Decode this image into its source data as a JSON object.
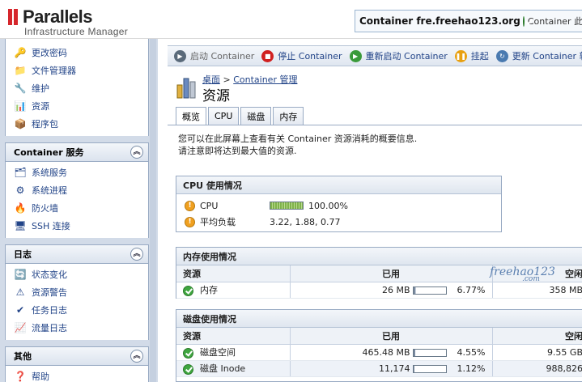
{
  "header": {
    "logo_name": "Parallels",
    "logo_sub": "Infrastructure Manager",
    "container_name": "Container fre.freehao123.org",
    "container_status": "Container 此时的状"
  },
  "sidebar": {
    "top_items": [
      {
        "label": "更改密码",
        "icon": "key-icon"
      },
      {
        "label": "文件管理器",
        "icon": "folder-icon"
      },
      {
        "label": "维护",
        "icon": "wrench-icon"
      },
      {
        "label": "资源",
        "icon": "bar-chart-icon"
      },
      {
        "label": "程序包",
        "icon": "package-icon"
      }
    ],
    "sections": [
      {
        "title": "Container 服务",
        "items": [
          {
            "label": "系统服务",
            "icon": "services-icon"
          },
          {
            "label": "系统进程",
            "icon": "gears-icon"
          },
          {
            "label": "防火墙",
            "icon": "firewall-icon"
          },
          {
            "label": "SSH 连接",
            "icon": "terminal-icon"
          }
        ]
      },
      {
        "title": "日志",
        "items": [
          {
            "label": "状态变化",
            "icon": "status-log-icon"
          },
          {
            "label": "资源警告",
            "icon": "warning-log-icon"
          },
          {
            "label": "任务日志",
            "icon": "task-log-icon"
          },
          {
            "label": "流量日志",
            "icon": "traffic-log-icon"
          }
        ]
      },
      {
        "title": "其他",
        "items": [
          {
            "label": "帮助",
            "icon": "help-icon"
          }
        ]
      }
    ]
  },
  "toolbar": {
    "start": "启动 Container",
    "stop": "停止 Container",
    "restart": "重新启动 Container",
    "suspend": "挂起",
    "update": "更新 Container 软件"
  },
  "breadcrumb": {
    "home": "桌面",
    "sep": ">",
    "current": "Container 管理"
  },
  "page_title": "资源",
  "tabs": [
    "概览",
    "CPU",
    "磁盘",
    "内存"
  ],
  "intro": {
    "line1": "您可以在此屏幕上查看有关 Container 资源消耗的概要信息.",
    "line2": "请注意即将达到最大值的资源."
  },
  "cpu_panel": {
    "title": "CPU 使用情况",
    "rows": [
      {
        "label": "CPU",
        "value": "100.00%",
        "fill": 1.0
      },
      {
        "label": "平均负载",
        "value": "3.22, 1.88, 0.77"
      }
    ]
  },
  "mem_panel": {
    "title": "内存使用情况",
    "headers": {
      "resource": "资源",
      "used": "已用",
      "free": "空闲"
    },
    "rows": [
      {
        "label": "内存",
        "used": "26 MB",
        "percent": "6.77%",
        "fill": 0.0677,
        "free": "358 MB"
      }
    ]
  },
  "disk_panel": {
    "title": "磁盘使用情况",
    "headers": {
      "resource": "资源",
      "used": "已用",
      "free": "空闲"
    },
    "rows": [
      {
        "label": "磁盘空间",
        "used": "465.48 MB",
        "percent": "4.55%",
        "fill": 0.0455,
        "free": "9.55 GB"
      },
      {
        "label": "磁盘 Inode",
        "used": "11,174",
        "percent": "1.12%",
        "fill": 0.0112,
        "free": "988,826"
      }
    ]
  },
  "watermark": {
    "text": "freehao123",
    "sub": ".com"
  }
}
